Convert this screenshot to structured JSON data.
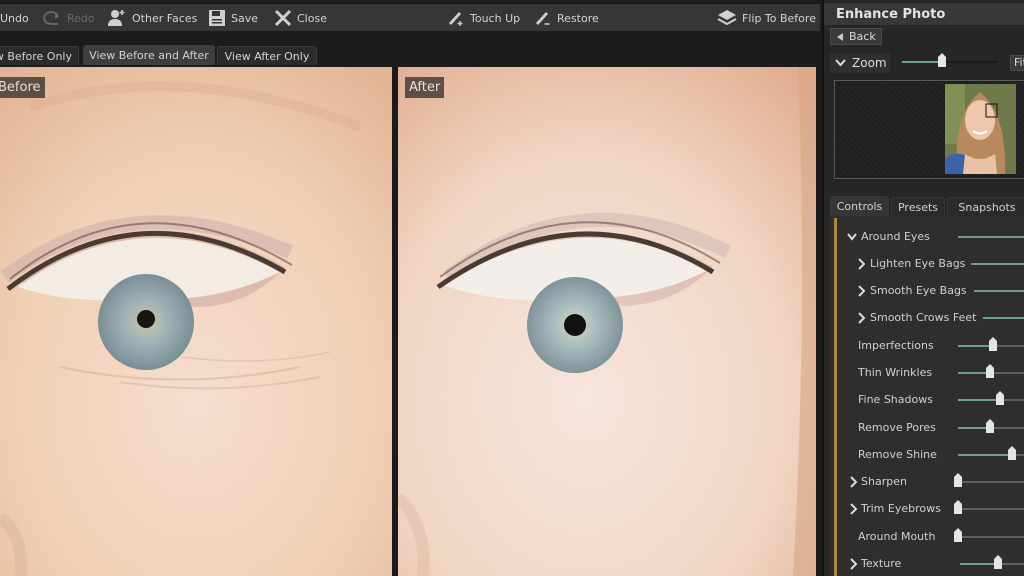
{
  "toolbar": {
    "undo": "Undo",
    "redo": "Redo",
    "other_faces": "Other Faces",
    "save": "Save",
    "close": "Close",
    "touch_up": "Touch Up",
    "restore": "Restore",
    "flip_to_before": "Flip To Before"
  },
  "view_tabs": [
    {
      "label": "View Before Only",
      "active": false
    },
    {
      "label": "View Before and After",
      "active": true
    },
    {
      "label": "View After Only",
      "active": false
    }
  ],
  "panes": {
    "before_label": "Before",
    "after_label": "After"
  },
  "right_panel": {
    "title": "Enhance Photo",
    "back": "Back",
    "zoom_label": "Zoom",
    "zoom_level": 0.42,
    "fit": "Fit"
  },
  "control_tabs": [
    {
      "label": "Controls",
      "active": true
    },
    {
      "label": "Presets",
      "active": false
    },
    {
      "label": "Snapshots",
      "active": false
    }
  ],
  "controls": [
    {
      "label": "Around Eyes",
      "chevron": "down",
      "indent": 0,
      "value": 1.0,
      "thumb": false
    },
    {
      "label": "Lighten Eye Bags",
      "chevron": "right",
      "indent": 1,
      "value": 1.0,
      "thumb": false
    },
    {
      "label": "Smooth Eye Bags",
      "chevron": "right",
      "indent": 1,
      "value": 1.0,
      "thumb": false
    },
    {
      "label": "Smooth Crows Feet",
      "chevron": "right",
      "indent": 1,
      "value": 1.0,
      "thumb": false
    },
    {
      "label": "Imperfections",
      "chevron": "none",
      "indent": 1,
      "value": 0.55,
      "thumb": true
    },
    {
      "label": "Thin Wrinkles",
      "chevron": "none",
      "indent": 1,
      "value": 0.5,
      "thumb": true
    },
    {
      "label": "Fine Shadows",
      "chevron": "none",
      "indent": 1,
      "value": 0.65,
      "thumb": true
    },
    {
      "label": "Remove Pores",
      "chevron": "none",
      "indent": 1,
      "value": 0.5,
      "thumb": true
    },
    {
      "label": "Remove Shine",
      "chevron": "none",
      "indent": 1,
      "value": 0.85,
      "thumb": true
    },
    {
      "label": "Sharpen",
      "chevron": "right",
      "indent": 0,
      "value": 0.0,
      "thumb": true
    },
    {
      "label": "Trim Eyebrows",
      "chevron": "right",
      "indent": 0,
      "value": 0.0,
      "thumb": true
    },
    {
      "label": "Around Mouth",
      "chevron": "none",
      "indent": 0,
      "value": 0.0,
      "thumb": true
    },
    {
      "label": "Texture",
      "chevron": "right",
      "indent": 0,
      "value": 0.6,
      "thumb": true
    }
  ],
  "colors": {
    "slider_fill": "#6f9e8a",
    "accent_bar": "#b08a3e"
  }
}
